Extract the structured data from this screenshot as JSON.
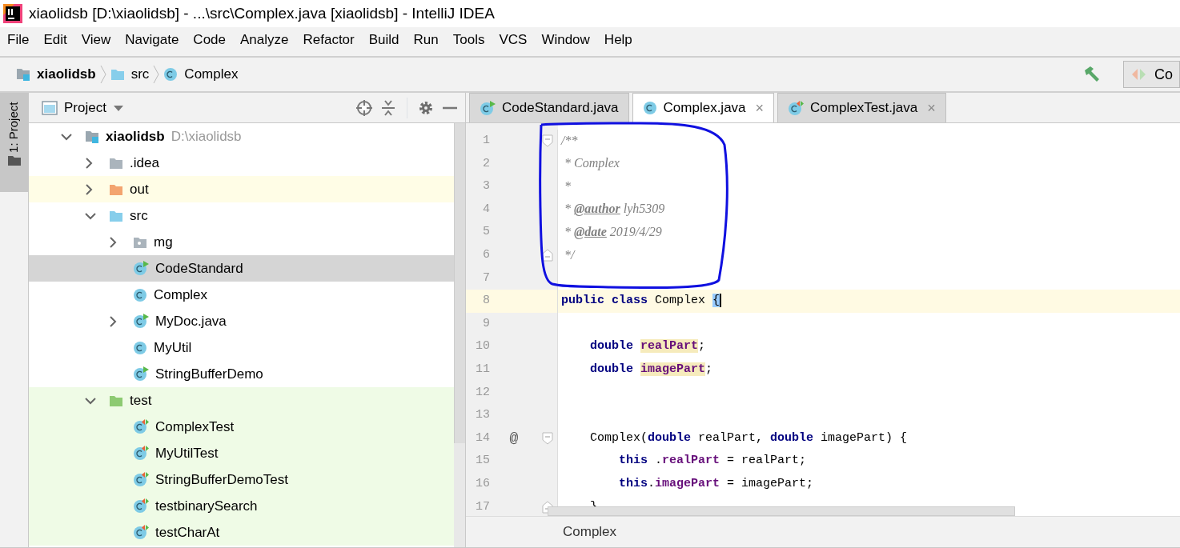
{
  "window": {
    "title": "xiaolidsb [D:\\xiaolidsb] - ...\\src\\Complex.java [xiaolidsb] - IntelliJ IDEA"
  },
  "menu": [
    "File",
    "Edit",
    "View",
    "Navigate",
    "Code",
    "Analyze",
    "Refactor",
    "Build",
    "Run",
    "Tools",
    "VCS",
    "Window",
    "Help"
  ],
  "navbar": {
    "breadcrumbs": [
      {
        "label": "xiaolidsb",
        "kind": "module"
      },
      {
        "label": "src",
        "kind": "folder_source"
      },
      {
        "label": "Complex",
        "kind": "class"
      }
    ],
    "run_config": {
      "label": "Co"
    }
  },
  "tool_strip": {
    "tabs": [
      {
        "label": "1: Project",
        "selected": true
      }
    ]
  },
  "project_panel": {
    "title": "Project",
    "tree": [
      {
        "label": "xiaolidsb",
        "hint": "D:\\xiaolidsb",
        "kind": "module",
        "expanded": true,
        "selected": false,
        "excluded": false,
        "test": false,
        "children": [
          {
            "label": ".idea",
            "kind": "folder",
            "expanded": false,
            "selected": false,
            "excluded": false,
            "test": false
          },
          {
            "label": "out",
            "kind": "folder_excluded",
            "expanded": false,
            "selected": false,
            "excluded": true,
            "test": false
          },
          {
            "label": "src",
            "kind": "folder_source",
            "expanded": true,
            "selected": false,
            "excluded": false,
            "test": false,
            "children": [
              {
                "label": "mg",
                "kind": "package",
                "expanded": false,
                "selected": false,
                "excluded": false,
                "test": false
              },
              {
                "label": "CodeStandard",
                "kind": "class_main",
                "selected": true,
                "excluded": false,
                "test": false
              },
              {
                "label": "Complex",
                "kind": "class",
                "selected": false,
                "excluded": false,
                "test": false
              },
              {
                "label": "MyDoc.java",
                "kind": "class_main",
                "expanded": false,
                "selected": false,
                "excluded": false,
                "test": false
              },
              {
                "label": "MyUtil",
                "kind": "class",
                "selected": false,
                "excluded": false,
                "test": false
              },
              {
                "label": "StringBufferDemo",
                "kind": "class_main",
                "selected": false,
                "excluded": false,
                "test": false
              }
            ]
          },
          {
            "label": "test",
            "kind": "folder_test",
            "expanded": true,
            "selected": false,
            "excluded": false,
            "test": true,
            "children": [
              {
                "label": "ComplexTest",
                "kind": "class_test",
                "selected": false,
                "excluded": false,
                "test": true
              },
              {
                "label": "MyUtilTest",
                "kind": "class_test",
                "selected": false,
                "excluded": false,
                "test": true
              },
              {
                "label": "StringBufferDemoTest",
                "kind": "class_test",
                "selected": false,
                "excluded": false,
                "test": true
              },
              {
                "label": "testbinarySearch",
                "kind": "class_test",
                "selected": false,
                "excluded": false,
                "test": true
              },
              {
                "label": "testCharAt",
                "kind": "class_test",
                "selected": false,
                "excluded": false,
                "test": true
              }
            ]
          }
        ]
      }
    ]
  },
  "editor": {
    "tabs": [
      {
        "label": "CodeStandard.java",
        "kind": "class_main",
        "selected": false,
        "closable": false
      },
      {
        "label": "Complex.java",
        "kind": "class",
        "selected": true,
        "closable": true
      },
      {
        "label": "ComplexTest.java",
        "kind": "class_test",
        "selected": false,
        "closable": true
      }
    ],
    "close_glyph": "×",
    "lines": [
      {
        "number": "1",
        "current": false,
        "fold_start": true,
        "tokens": [
          {
            "kind": "comment",
            "text": "/**"
          }
        ]
      },
      {
        "number": "2",
        "current": false,
        "tokens": [
          {
            "kind": "comment",
            "text": " * Complex"
          }
        ]
      },
      {
        "number": "3",
        "current": false,
        "tokens": [
          {
            "kind": "comment",
            "text": " *"
          }
        ]
      },
      {
        "number": "4",
        "current": false,
        "tokens": [
          {
            "kind": "comment",
            "text": " * "
          },
          {
            "kind": "doc_tag",
            "text": "@author"
          },
          {
            "kind": "comment",
            "text": " lyh5309"
          }
        ]
      },
      {
        "number": "5",
        "current": false,
        "tokens": [
          {
            "kind": "comment",
            "text": " * "
          },
          {
            "kind": "doc_tag",
            "text": "@date"
          },
          {
            "kind": "comment",
            "text": " 2019/4/29"
          }
        ]
      },
      {
        "number": "6",
        "current": false,
        "fold_end": true,
        "tokens": [
          {
            "kind": "comment",
            "text": " */"
          }
        ]
      },
      {
        "number": "7",
        "current": false
      },
      {
        "number": "8",
        "current": true,
        "tokens": [
          {
            "kind": "keyword",
            "text": "public class"
          },
          {
            "kind": "plain",
            "text": " Complex "
          },
          {
            "kind": "brace_match",
            "text": "{"
          }
        ]
      },
      {
        "number": "9",
        "current": false
      },
      {
        "number": "10",
        "current": false,
        "tokens": [
          {
            "kind": "keyword",
            "text": "    double"
          },
          {
            "kind": "field_decl",
            "text": " realPart"
          },
          {
            "kind": "plain",
            "text": ";"
          }
        ]
      },
      {
        "number": "11",
        "current": false,
        "tokens": [
          {
            "kind": "keyword",
            "text": "    double"
          },
          {
            "kind": "field_decl",
            "text": " imagePart"
          },
          {
            "kind": "plain",
            "text": ";"
          }
        ]
      },
      {
        "number": "12",
        "current": false
      },
      {
        "number": "13",
        "current": false
      },
      {
        "number": "14",
        "current": false,
        "fold_start": true,
        "gutter": "@",
        "tokens": [
          {
            "kind": "plain",
            "text": "    Complex("
          },
          {
            "kind": "keyword",
            "text": "double"
          },
          {
            "kind": "plain",
            "text": " realPart, "
          },
          {
            "kind": "keyword",
            "text": "double"
          },
          {
            "kind": "plain",
            "text": " imagePart) {"
          }
        ]
      },
      {
        "number": "15",
        "current": false,
        "tokens": [
          {
            "kind": "keyword",
            "text": "        this"
          },
          {
            "kind": "plain",
            "text": " ."
          },
          {
            "kind": "field",
            "text": "realPart"
          },
          {
            "kind": "plain",
            "text": " = realPart;"
          }
        ]
      },
      {
        "number": "16",
        "current": false,
        "tokens": [
          {
            "kind": "keyword",
            "text": "        this"
          },
          {
            "kind": "plain",
            "text": "."
          },
          {
            "kind": "field",
            "text": "imagePart"
          },
          {
            "kind": "plain",
            "text": " = imagePart;"
          }
        ]
      },
      {
        "number": "17",
        "current": false,
        "fold_end": true,
        "tokens": [
          {
            "kind": "plain",
            "text": "    }"
          }
        ]
      }
    ],
    "breadcrumb": "Complex"
  }
}
